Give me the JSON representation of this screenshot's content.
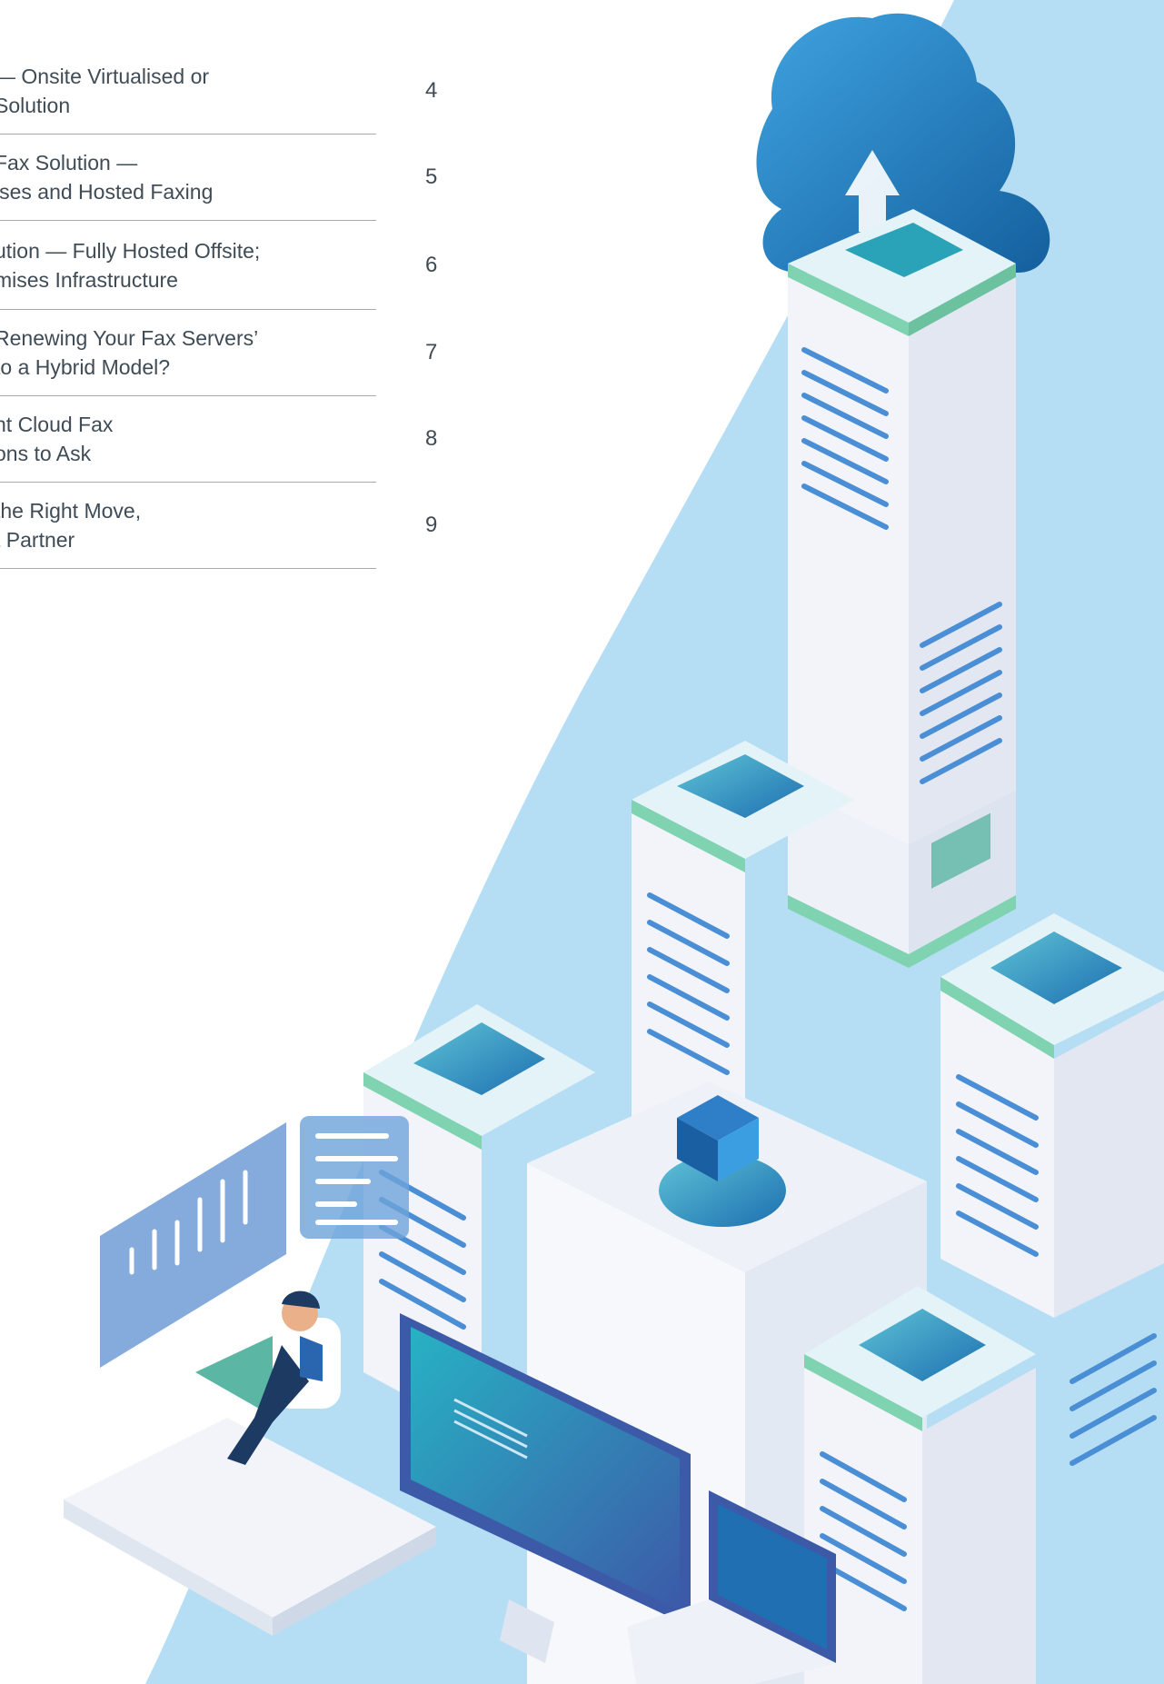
{
  "toc": {
    "items": [
      {
        "title": "— Onsite Virtualised or\nSolution",
        "page": "4"
      },
      {
        "title": "Fax Solution —\nises and Hosted Faxing",
        "page": "5"
      },
      {
        "title": "ution — Fully Hosted Offsite;\nmises Infrastructure",
        "page": "6"
      },
      {
        "title": "Renewing Your Fax Servers’\n to a Hybrid Model?",
        "page": "7"
      },
      {
        "title": "nt Cloud Fax\nons to Ask",
        "page": "8"
      },
      {
        "title": " the Right Move,\nt Partner",
        "page": "9"
      }
    ]
  },
  "colors": {
    "background_sky": "#b5def5",
    "server_white": "#f2f4fa",
    "server_stripe": "#4a8fd6",
    "accent_green": "#7fd3b0",
    "accent_teal": "#2aa3b8",
    "cloud_blue": "#1f7fc4"
  },
  "illustration": {
    "icons": [
      "cloud-upload-icon",
      "server-tower",
      "monitor",
      "laptop",
      "person-at-desk",
      "floating-chart-panel",
      "floating-text-panel",
      "isometric-cube-platform"
    ]
  }
}
